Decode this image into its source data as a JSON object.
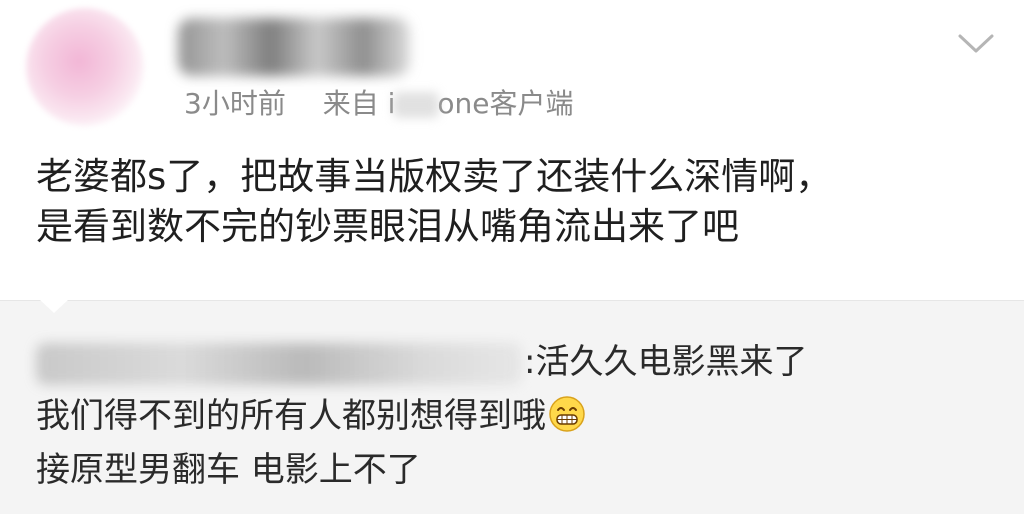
{
  "post": {
    "time": "3小时前",
    "source_prefix": "来自 i",
    "source_suffix": "one客户端",
    "content_lines": [
      "老婆都s了，把故事当版权卖了还装什么深情啊，",
      "是看到数不完的钞票眼泪从嘴角流出来了吧"
    ]
  },
  "comment": {
    "line1_text": ":活久久电影黑来了",
    "line2_text": "我们得不到的所有人都别想得到哦",
    "line3_text": "接原型男翻车 电影上不了"
  },
  "icons": {
    "menu": "chevron-down-icon",
    "emoji": "grinning-face-icon"
  },
  "colors": {
    "meta_text": "#8a8a8a",
    "comment_bg": "#f4f4f4",
    "body_text": "#1f1f1f"
  }
}
